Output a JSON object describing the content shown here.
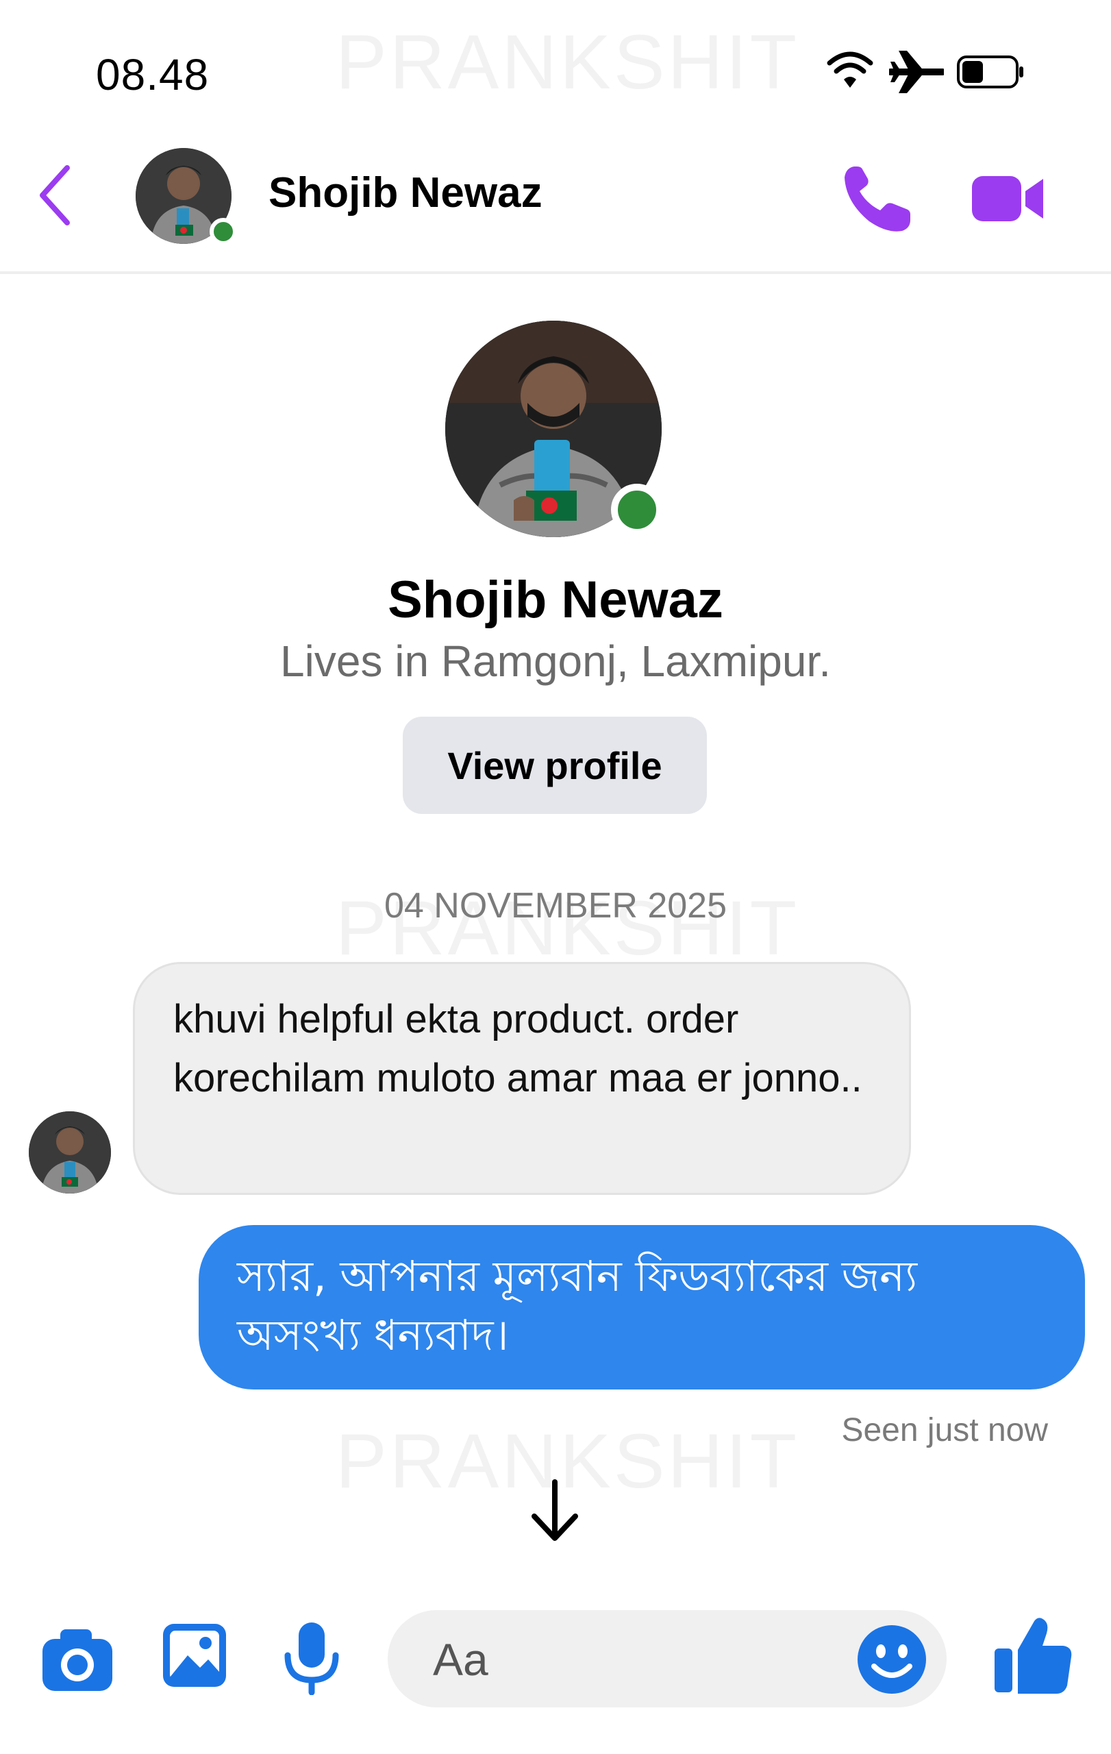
{
  "status_bar": {
    "time": "08.48",
    "icons": [
      "wifi-icon",
      "airplane-mode-icon",
      "battery-icon"
    ]
  },
  "watermark": "PRANKSHIT",
  "header": {
    "back_icon": "chevron-left-icon",
    "contact_name": "Shojib Newaz",
    "online": true,
    "actions": [
      "phone-icon",
      "video-camera-icon"
    ]
  },
  "profile": {
    "name": "Shojib Newaz",
    "subtitle": "Lives in Ramgonj, Laxmipur.",
    "view_profile_label": "View profile"
  },
  "conversation": {
    "date_separator": "04 NOVEMBER 2025",
    "messages": [
      {
        "direction": "incoming",
        "text": "khuvi helpful ekta product. order korechilam muloto amar maa er jonno.."
      },
      {
        "direction": "outgoing",
        "text": "স্যার, আপনার মূল্যবান ফিডব্যাকের জন্য অসংখ্য ধন্যবাদ।"
      }
    ],
    "seen_status": "Seen just now"
  },
  "composer": {
    "placeholder": "Aa",
    "actions": [
      "camera-icon",
      "image-icon",
      "microphone-icon",
      "emoji-icon",
      "thumbs-up-icon"
    ]
  },
  "colors": {
    "accent_purple": "#9b3cf0",
    "outgoing_bubble": "#2f86ec",
    "action_blue": "#1b74e4",
    "online_green": "#2f8d3a"
  }
}
